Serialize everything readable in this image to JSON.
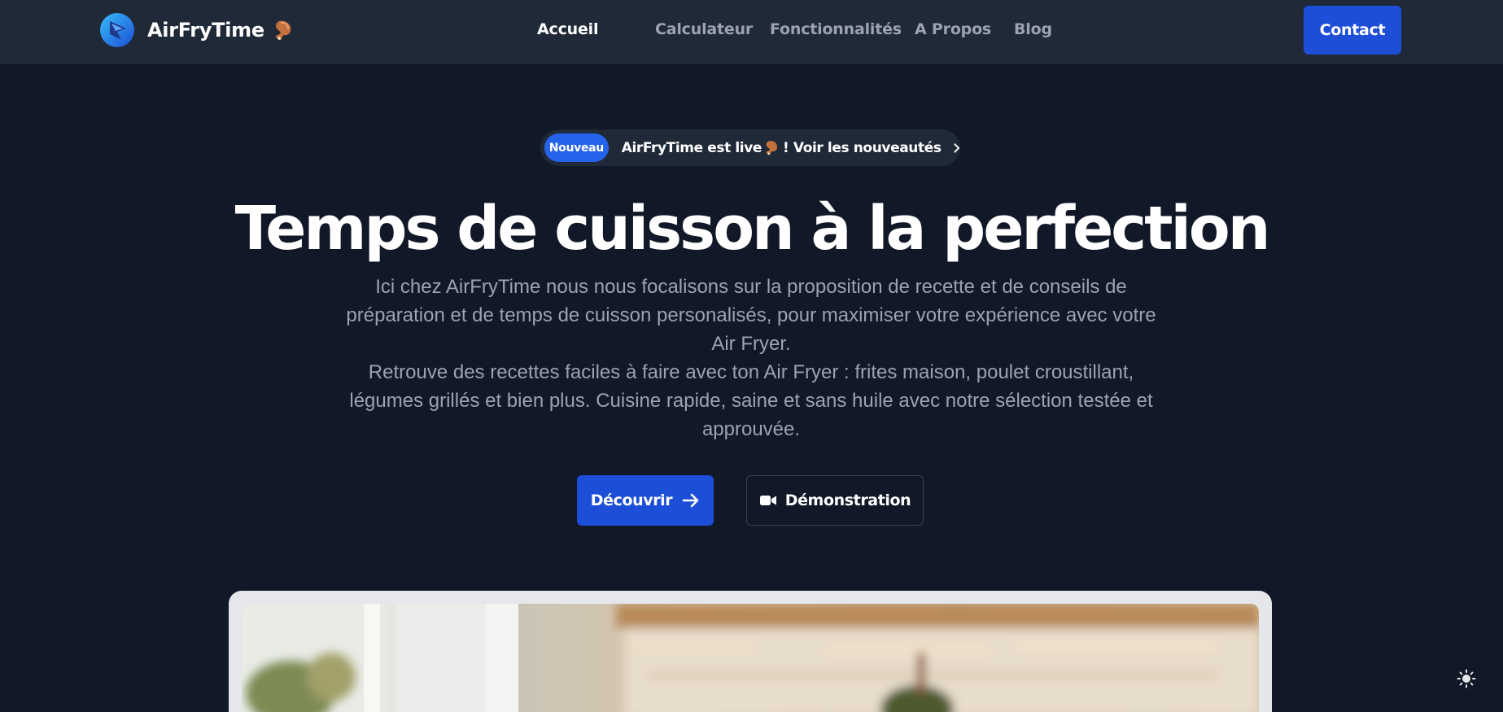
{
  "brand": {
    "name": "AirFryTime",
    "emoji_icon": "chicken-leg-icon",
    "logo_icon": "airfrytime-logo-icon"
  },
  "nav": {
    "links": [
      {
        "label": "Accueil",
        "active": true
      },
      {
        "label": "Calculateur",
        "active": false
      },
      {
        "label": "Fonctionnalités",
        "active": false
      },
      {
        "label": "A Propos",
        "active": false
      },
      {
        "label": "Blog",
        "active": false
      }
    ],
    "contact_label": "Contact"
  },
  "announcement": {
    "badge": "Nouveau",
    "text_before": "AirFryTime est live",
    "text_after": "! Voir les nouveautés"
  },
  "hero": {
    "title": "Temps de cuisson à la perfection",
    "paragraph_1": "Ici chez AirFryTime nous nous focalisons sur la proposition de recette et de conseils de préparation et de temps de cuisson personalisés, pour maximiser votre expérience avec votre Air Fryer.",
    "paragraph_2": "Retrouve des recettes faciles à faire avec ton Air Fryer : frites maison, poulet croustillant, légumes grillés et bien plus. Cuisine rapide, saine et sans huile avec notre sélection testée et approuvée.",
    "primary_cta": "Découvrir",
    "secondary_cta": "Démonstration"
  },
  "theme": {
    "toggle_icon": "sun-icon"
  },
  "colors": {
    "background": "#111827",
    "navbar": "#1f2937",
    "accent": "#1d4ed8",
    "badge": "#2563eb",
    "muted_text": "#9ca3af"
  }
}
